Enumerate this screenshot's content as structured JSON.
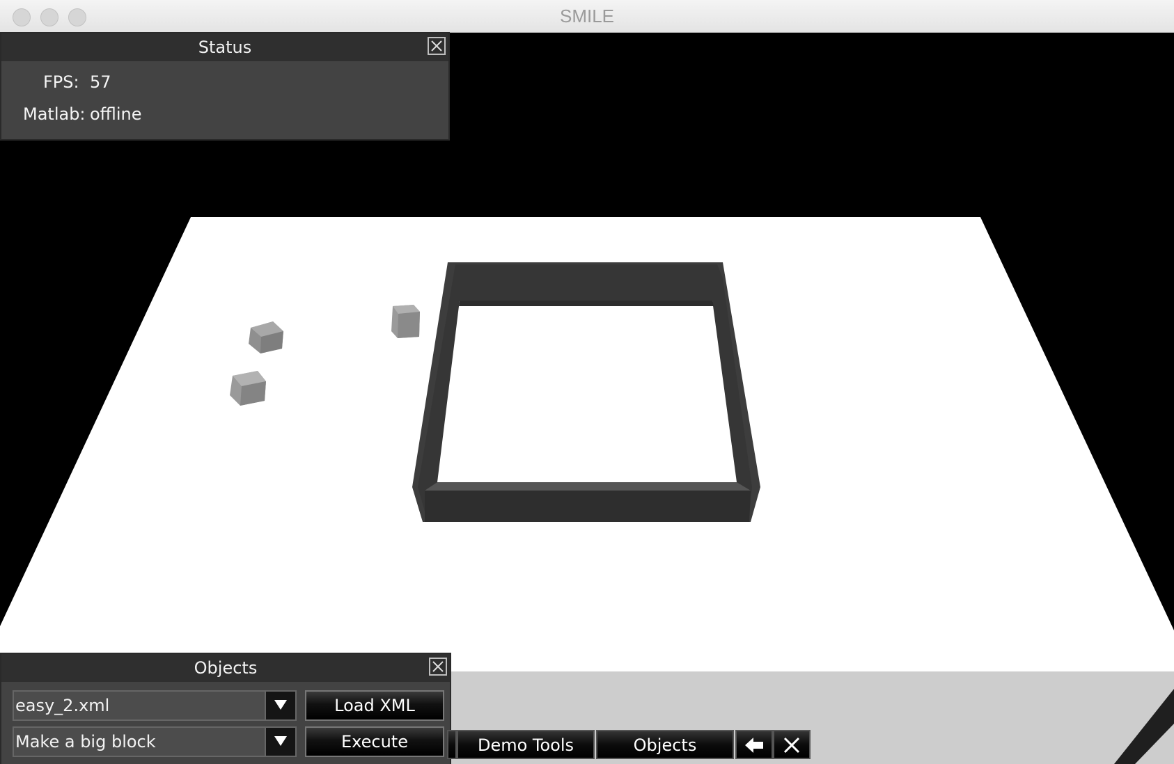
{
  "window": {
    "title": "SMILE"
  },
  "status_panel": {
    "title": "Status",
    "fps_label": "FPS:",
    "fps_value": "57",
    "matlab_label": "Matlab:",
    "matlab_value": "offline"
  },
  "objects_panel": {
    "title": "Objects",
    "file_select_value": "easy_2.xml",
    "load_button": "Load XML",
    "command_select_value": "Make a big block",
    "execute_button": "Execute"
  },
  "taskbar": {
    "demo_tools_tab": "Demo Tools",
    "objects_tab": "Objects",
    "back_icon": "arrow-left-icon",
    "close_icon": "close-icon"
  },
  "colors": {
    "background": "#000000",
    "table_top": "#ffffff",
    "table_side": "#cdcdcd",
    "frame": "#3a3a3a",
    "block": "#9a9a9a",
    "panel": "#434343",
    "panel_header": "#2f2f2f"
  }
}
